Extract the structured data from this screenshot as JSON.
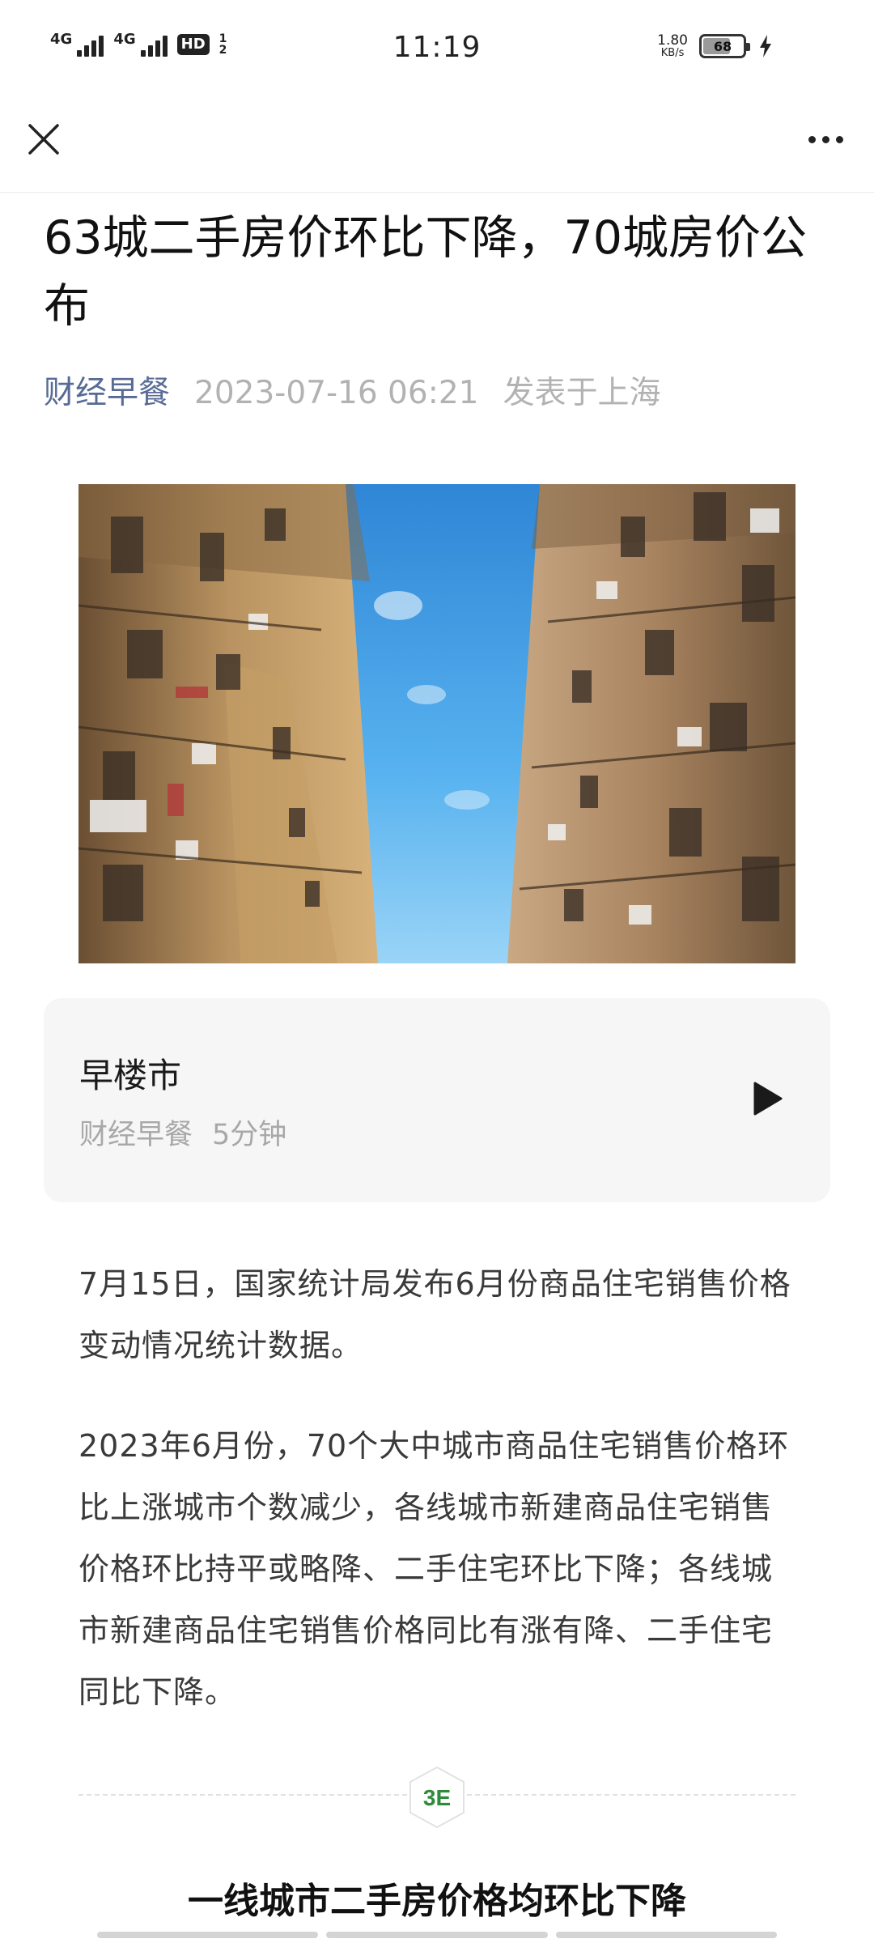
{
  "status_bar": {
    "signal1_label": "4G",
    "signal2_label": "4G",
    "hd_label": "HD",
    "hd_sub_top": "1",
    "hd_sub_bottom": "2",
    "time": "11:19",
    "net_speed": "1.80",
    "net_unit": "KB/s",
    "battery_level": 68,
    "battery_text": "68"
  },
  "nav": {
    "close_icon": "close-icon",
    "more_icon": "more-icon"
  },
  "article": {
    "title": "63城二手房价环比下降，70城房价公布",
    "author": "财经早餐",
    "date": "2023-07-16 06:21",
    "location": "发表于上海"
  },
  "audio": {
    "title": "早楼市",
    "source": "财经早餐",
    "duration": "5分钟",
    "play_icon": "play-icon"
  },
  "body": {
    "paragraph_1": "7月15日，国家统计局发布6月份商品住宅销售价格变动情况统计数据。",
    "paragraph_2": "2023年6月份，70个大中城市商品住宅销售价格环比上涨城市个数减少，各线城市新建商品住宅销售价格环比持平或略降、二手住宅环比下降；各线城市新建商品住宅销售价格同比有涨有降、二手住宅同比下降。",
    "emblem_text": "3E",
    "section_heading": "一线城市二手房价格均环比下降"
  },
  "colors": {
    "author_link": "#576b95",
    "meta_gray": "#b2b2b2",
    "card_bg": "#f6f6f6",
    "emblem_green": "#2e8b3a"
  }
}
